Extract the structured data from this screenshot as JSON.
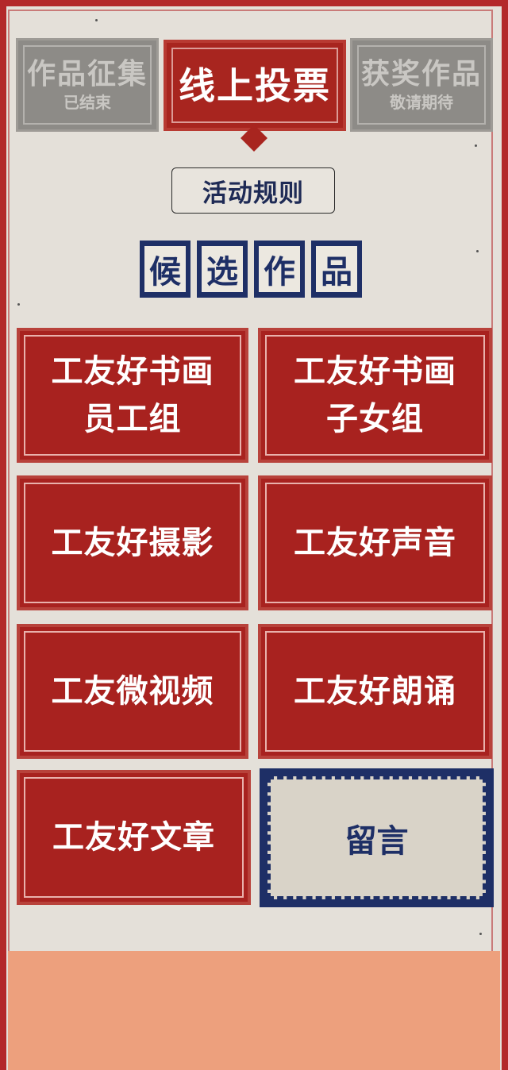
{
  "tabs": [
    {
      "title": "作品征集",
      "subtitle": "已结束",
      "state": "inactive"
    },
    {
      "title": "线上投票",
      "subtitle": "",
      "state": "active"
    },
    {
      "title": "获奖作品",
      "subtitle": "敬请期待",
      "state": "inactive"
    }
  ],
  "rules_button": "活动规则",
  "section_title": [
    "候",
    "选",
    "作",
    "品"
  ],
  "categories": [
    "工友好书画\n员工组",
    "工友好书画\n子女组",
    "工友好摄影",
    "工友好声音",
    "工友微视频",
    "工友好朗诵",
    "工友好文章"
  ],
  "message_button": "留言",
  "colors": {
    "accent_red": "#a8221f",
    "navy": "#1e2f66",
    "paper": "#e4e0d9",
    "footer": "#eda07d",
    "inactive_gray": "#8d8b87"
  }
}
